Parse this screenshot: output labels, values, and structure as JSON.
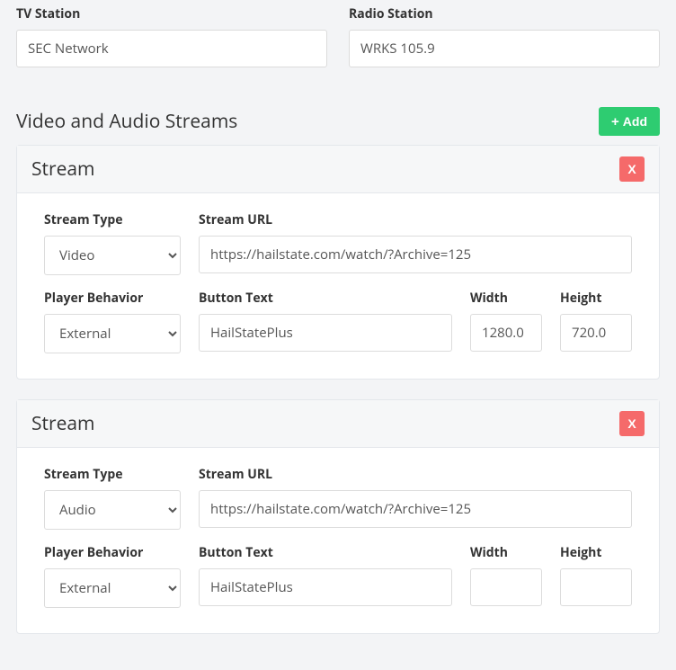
{
  "top": {
    "tv_label": "TV Station",
    "tv_value": "SEC Network",
    "radio_label": "Radio Station",
    "radio_value": "WRKS 105.9"
  },
  "section": {
    "title": "Video and Audio Streams",
    "add_label": "Add"
  },
  "streams": [
    {
      "panel_title": "Stream",
      "delete_label": "X",
      "labels": {
        "type": "Stream Type",
        "url": "Stream URL",
        "behavior": "Player Behavior",
        "button_text": "Button Text",
        "width": "Width",
        "height": "Height"
      },
      "values": {
        "type": "Video",
        "url": "https://hailstate.com/watch/?Archive=125",
        "behavior": "External",
        "button_text": "HailStatePlus",
        "width": "1280.0",
        "height": "720.0"
      }
    },
    {
      "panel_title": "Stream",
      "delete_label": "X",
      "labels": {
        "type": "Stream Type",
        "url": "Stream URL",
        "behavior": "Player Behavior",
        "button_text": "Button Text",
        "width": "Width",
        "height": "Height"
      },
      "values": {
        "type": "Audio",
        "url": "https://hailstate.com/watch/?Archive=125",
        "behavior": "External",
        "button_text": "HailStatePlus",
        "width": "",
        "height": ""
      }
    }
  ]
}
